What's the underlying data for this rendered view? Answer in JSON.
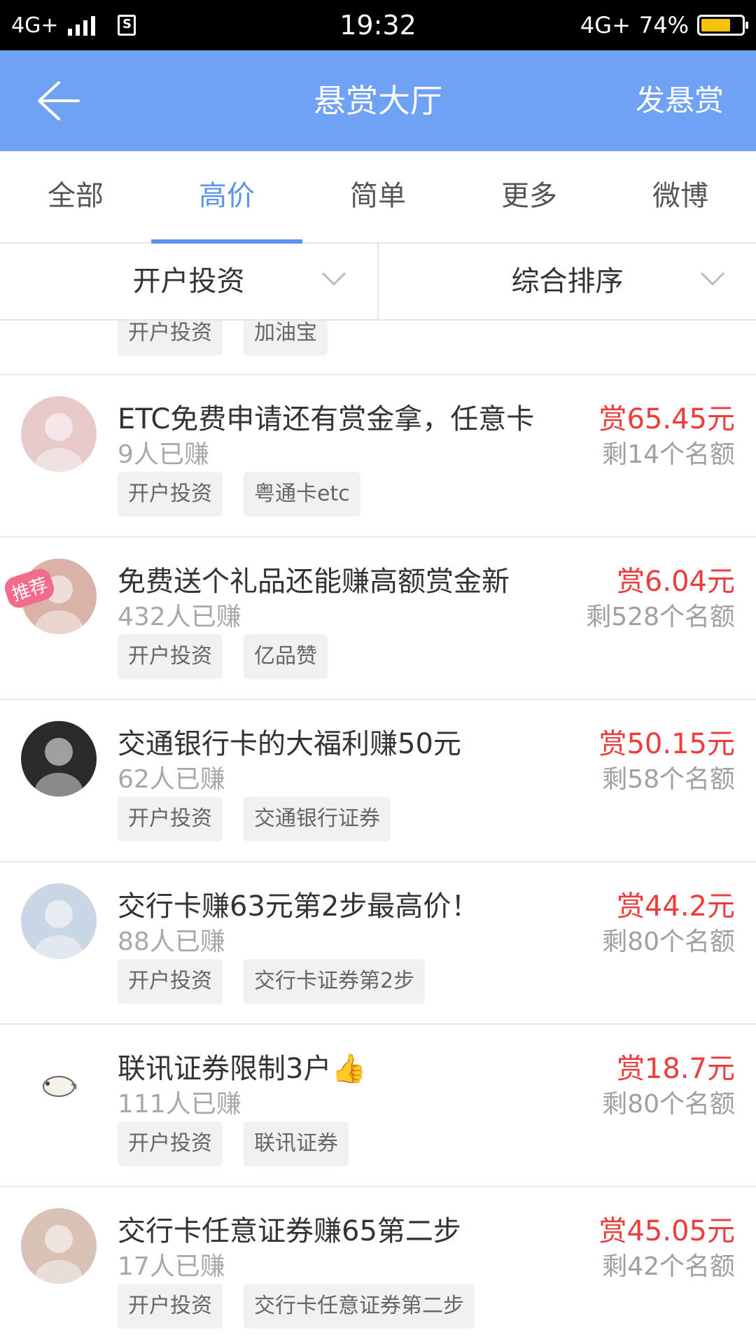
{
  "status_bar": {
    "network_left": "4G+",
    "time": "19:32",
    "network_right": "4G+",
    "battery": "74%",
    "battery_level": 0.74
  },
  "header": {
    "title": "悬赏大厅",
    "action": "发悬赏",
    "back_icon": "arrow-left-icon"
  },
  "tabs": [
    "全部",
    "高价",
    "简单",
    "更多",
    "微博"
  ],
  "active_tab": "高价",
  "filters": {
    "category": "开户投资",
    "sort": "综合排序"
  },
  "partial_item": {
    "tags": [
      "开户投资",
      "加油宝"
    ]
  },
  "items": [
    {
      "title": "ETC免费申请还有赏金拿，任意卡",
      "earned": "9人已赚",
      "reward": "赏65.45元",
      "quota": "剩14个名额",
      "tags": [
        "开户投资",
        "粤通卡etc"
      ],
      "avatar_color": "#e8c9c9"
    },
    {
      "title": "免费送个礼品还能赚高额赏金新",
      "earned": "432人已赚",
      "reward": "赏6.04元",
      "quota": "剩528个名额",
      "tags": [
        "开户投资",
        "亿品赞"
      ],
      "badge": "推荐",
      "avatar_color": "#d9b3a8"
    },
    {
      "title": "交通银行卡的大福利赚50元",
      "earned": "62人已赚",
      "reward": "赏50.15元",
      "quota": "剩58个名额",
      "tags": [
        "开户投资",
        "交通银行证券"
      ],
      "avatar_color": "#2a2a2a"
    },
    {
      "title": "交行卡赚63元第2步最高价！",
      "earned": "88人已赚",
      "reward": "赏44.2元",
      "quota": "剩80个名额",
      "tags": [
        "开户投资",
        "交行卡证券第2步"
      ],
      "avatar_color": "#c9d6e3"
    },
    {
      "title": "联讯证券限制3户👍",
      "earned": "111人已赚",
      "reward": "赏18.7元",
      "quota": "剩80个名额",
      "tags": [
        "开户投资",
        "联讯证券"
      ],
      "avatar_color": "#ffffff"
    },
    {
      "title": "交行卡任意证券赚65第二步",
      "earned": "17人已赚",
      "reward": "赏45.05元",
      "quota": "剩42个名额",
      "tags": [
        "开户投资",
        "交行卡任意证券第二步"
      ],
      "avatar_color": "#d8c2b8"
    }
  ]
}
